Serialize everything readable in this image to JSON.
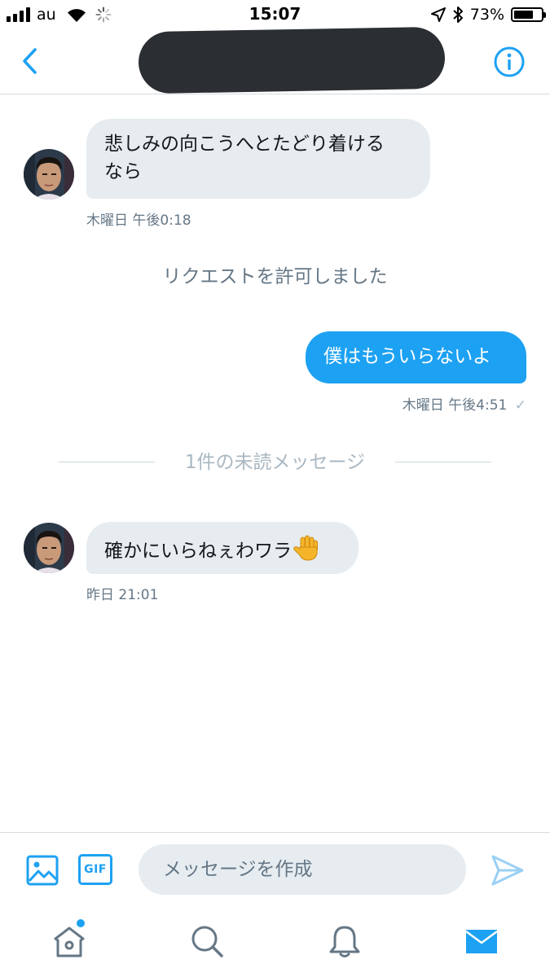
{
  "status_bar": {
    "carrier": "au",
    "time": "15:07",
    "battery_percent": "73%",
    "battery_level": 0.73,
    "signal_bars": 4,
    "icons": [
      "signal-icon",
      "wifi-icon",
      "activity-spinner-icon",
      "location-arrow-icon",
      "bluetooth-icon",
      "battery-icon"
    ]
  },
  "nav": {
    "back_icon": "chevron-left-icon",
    "title_redacted": true,
    "info_icon": "info-icon"
  },
  "conversation": {
    "messages": [
      {
        "direction": "incoming",
        "text_lines": [
          "悲しみの向こうへとたどり着ける",
          "なら"
        ],
        "meta": "木曜日 午後0:18"
      },
      {
        "direction": "incoming",
        "text": "確かにいらねぇわワラ",
        "emoji": "🖐",
        "meta": "昨日 21:01"
      }
    ],
    "system_message": "リクエストを許可しました",
    "outgoing": {
      "text": "僕はもういらないよ",
      "meta": "木曜日 午後4:51",
      "read_mark": "✓"
    },
    "unread_divider": "1件の未読メッセージ"
  },
  "composer": {
    "media_icon": "image-icon",
    "gif_label": "GIF",
    "placeholder": "メッセージを作成",
    "send_icon": "send-icon"
  },
  "tab_bar": {
    "tabs": [
      {
        "name": "home",
        "icon": "home-icon",
        "badge_dot": true
      },
      {
        "name": "search",
        "icon": "search-icon"
      },
      {
        "name": "notifications",
        "icon": "bell-icon"
      },
      {
        "name": "messages",
        "icon": "mail-icon",
        "active": true
      }
    ]
  },
  "colors": {
    "accent": "#1da1f2",
    "bubble_incoming": "#e6ecf0",
    "meta_text": "#657786",
    "redaction": "#2b2f33"
  }
}
